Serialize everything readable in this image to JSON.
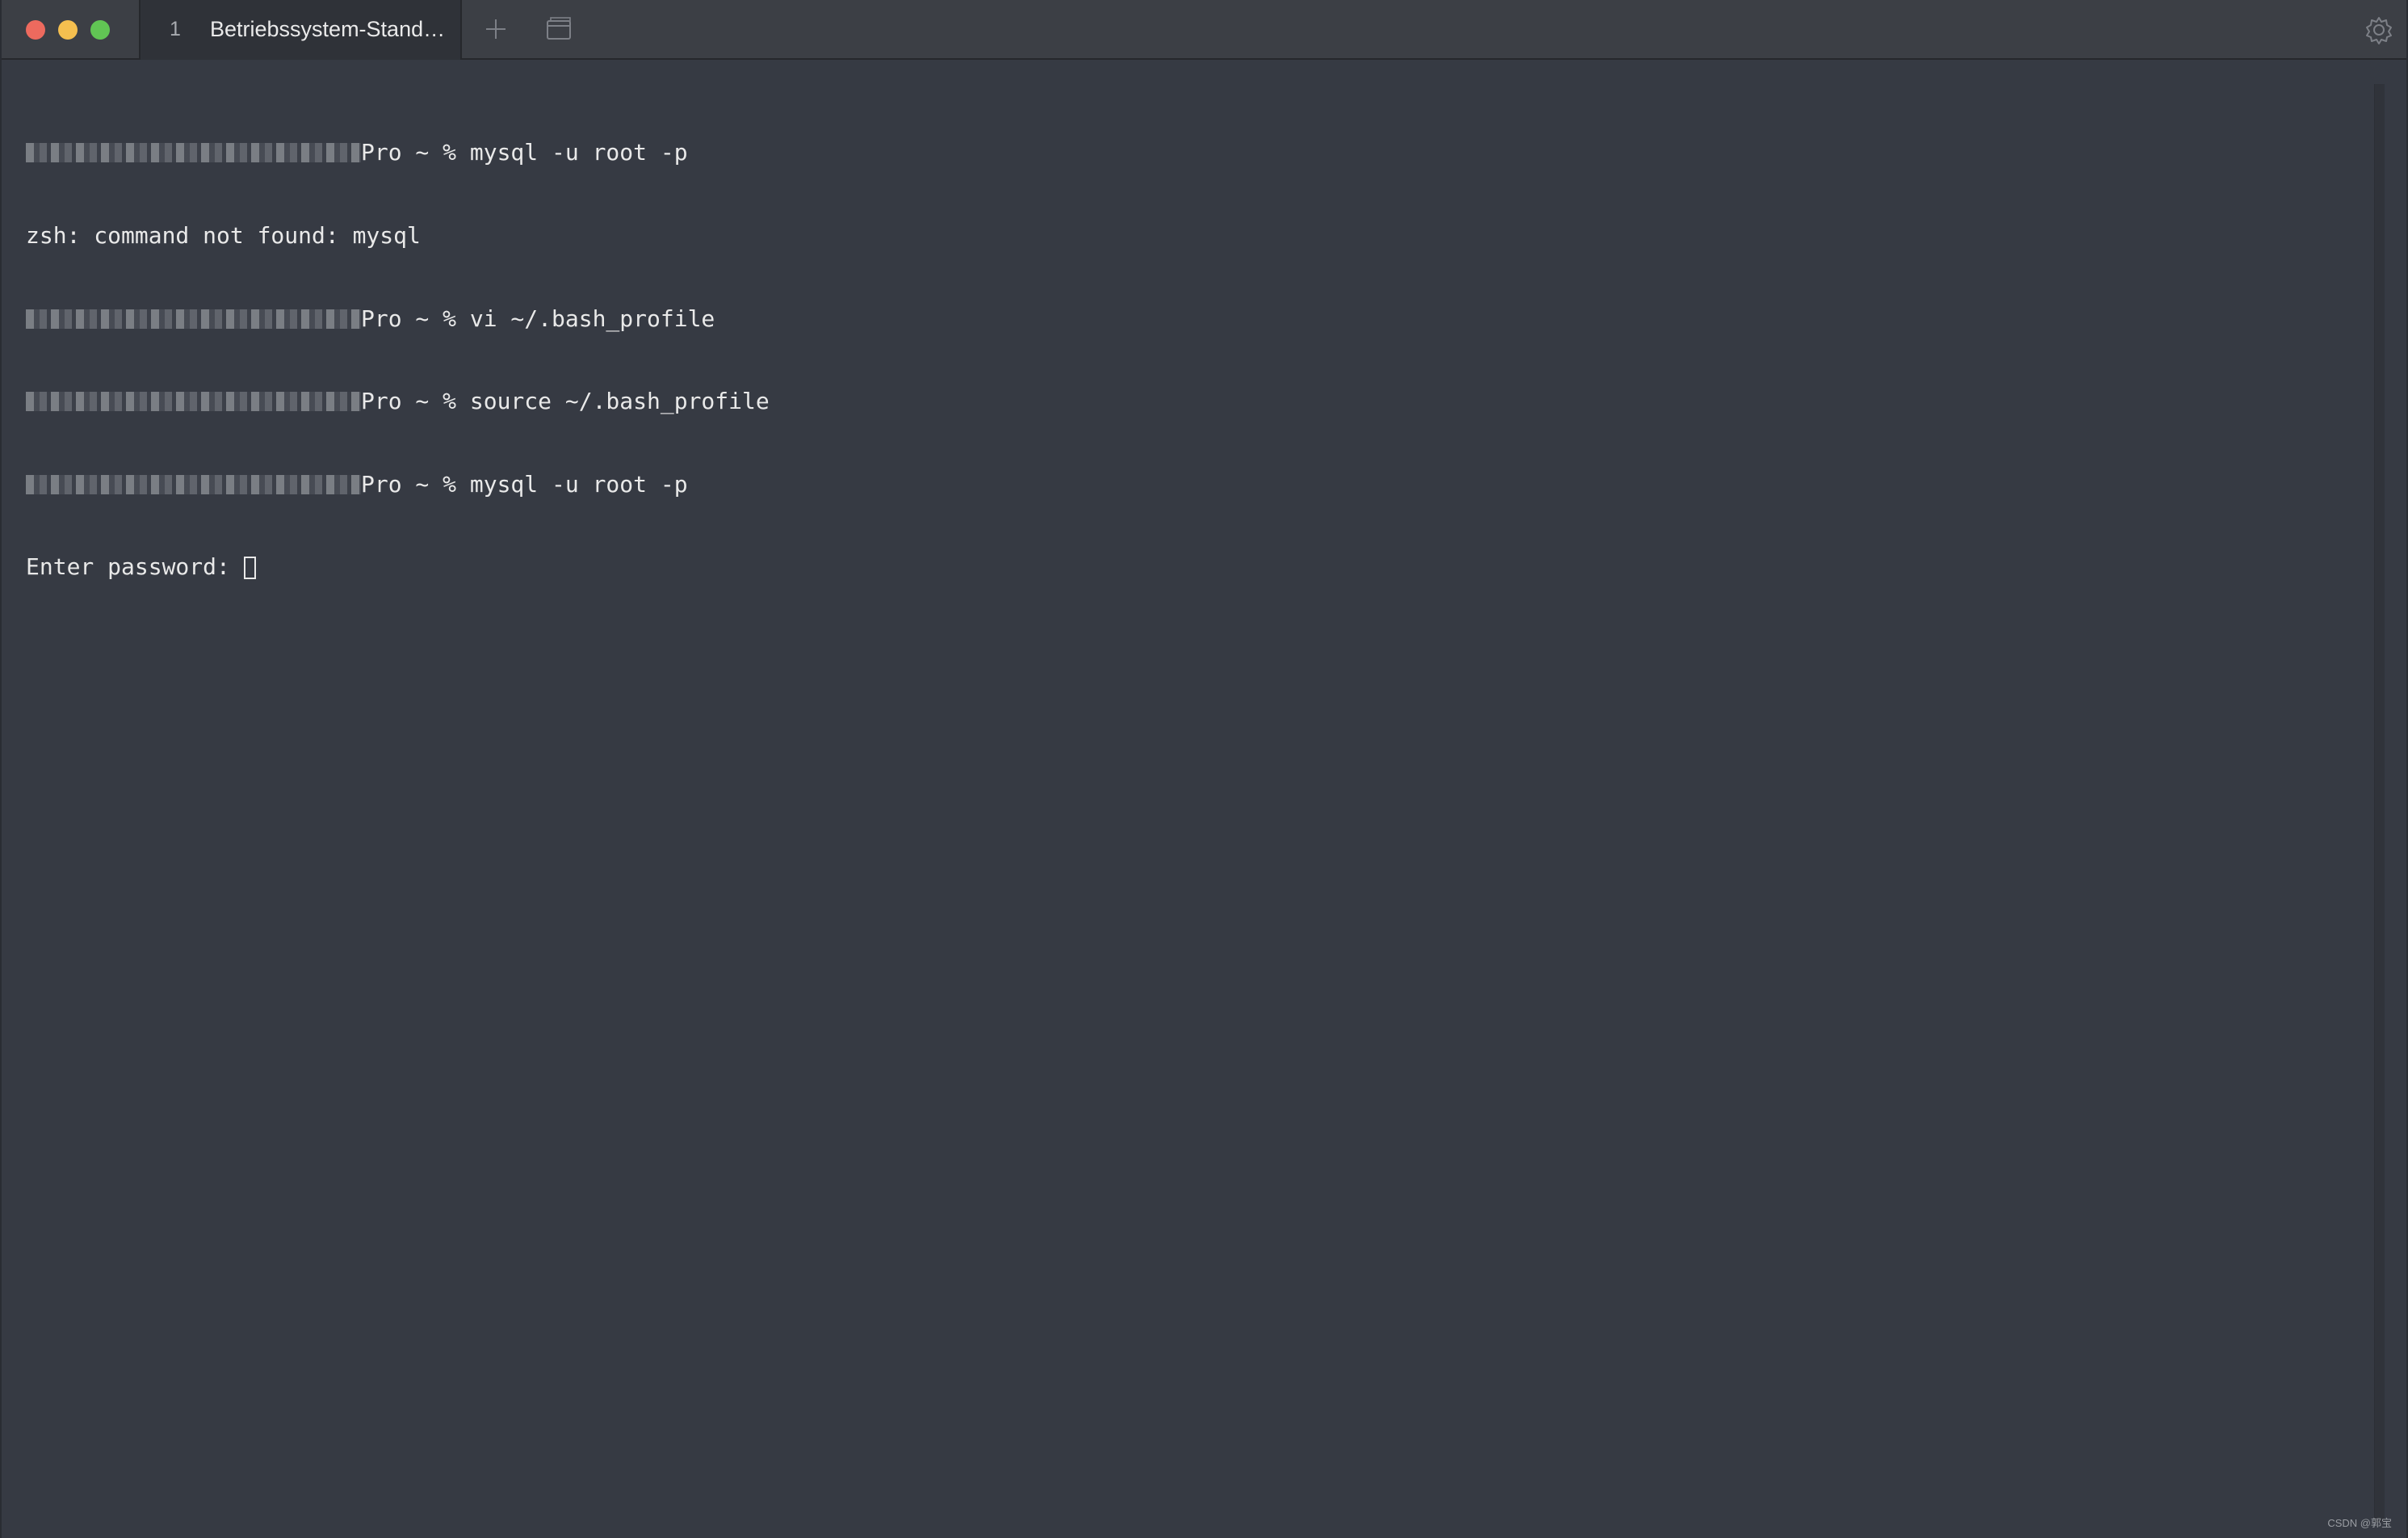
{
  "window": {
    "colors": {
      "background": "#363a43",
      "titlebar": "#3c3f45",
      "close": "#ed6a5e",
      "minimize": "#f5bf4f",
      "maximize": "#61c554"
    }
  },
  "tab": {
    "index": "1",
    "title": "Betriebssystem-Stand…"
  },
  "toolbar": {
    "new_tab_icon": "plus-icon",
    "split_icon": "window-icon",
    "settings_icon": "gear-icon"
  },
  "terminal": {
    "lines": [
      {
        "prompt_suffix": "Pro ~ % ",
        "text": "mysql -u root -p"
      },
      {
        "prompt_suffix": "",
        "text": "zsh: command not found: mysql"
      },
      {
        "prompt_suffix": "Pro ~ % ",
        "text": "vi ~/.bash_profile"
      },
      {
        "prompt_suffix": "Pro ~ % ",
        "text": "source ~/.bash_profile"
      },
      {
        "prompt_suffix": "Pro ~ % ",
        "text": "mysql -u root -p"
      },
      {
        "prompt_suffix": "",
        "text": "Enter password: "
      }
    ]
  },
  "watermark": "CSDN @郭宝"
}
